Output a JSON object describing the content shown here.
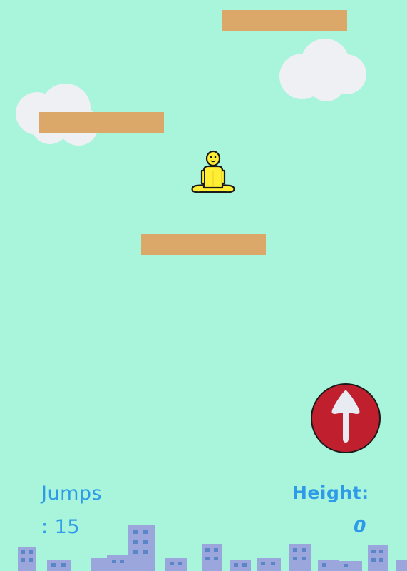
{
  "game": {
    "colors": {
      "sky": "#a8f5dc",
      "platform": "#dba86a",
      "cloud": "#eef0f4",
      "player": "#ffee33",
      "player_outline": "#1a1a1a",
      "button_fill": "#c0202e",
      "button_arrow": "#e8ecf2",
      "hud_text": "#2f9be8",
      "building": "#9aa6dc",
      "building_window": "#5a86c8"
    },
    "controls": {
      "jump_button_icon": "up-arrow-icon"
    },
    "hud": {
      "jumps_label": "Jumps",
      "jumps_value": ": 15",
      "height_label": "Height:",
      "height_value": "0"
    }
  }
}
